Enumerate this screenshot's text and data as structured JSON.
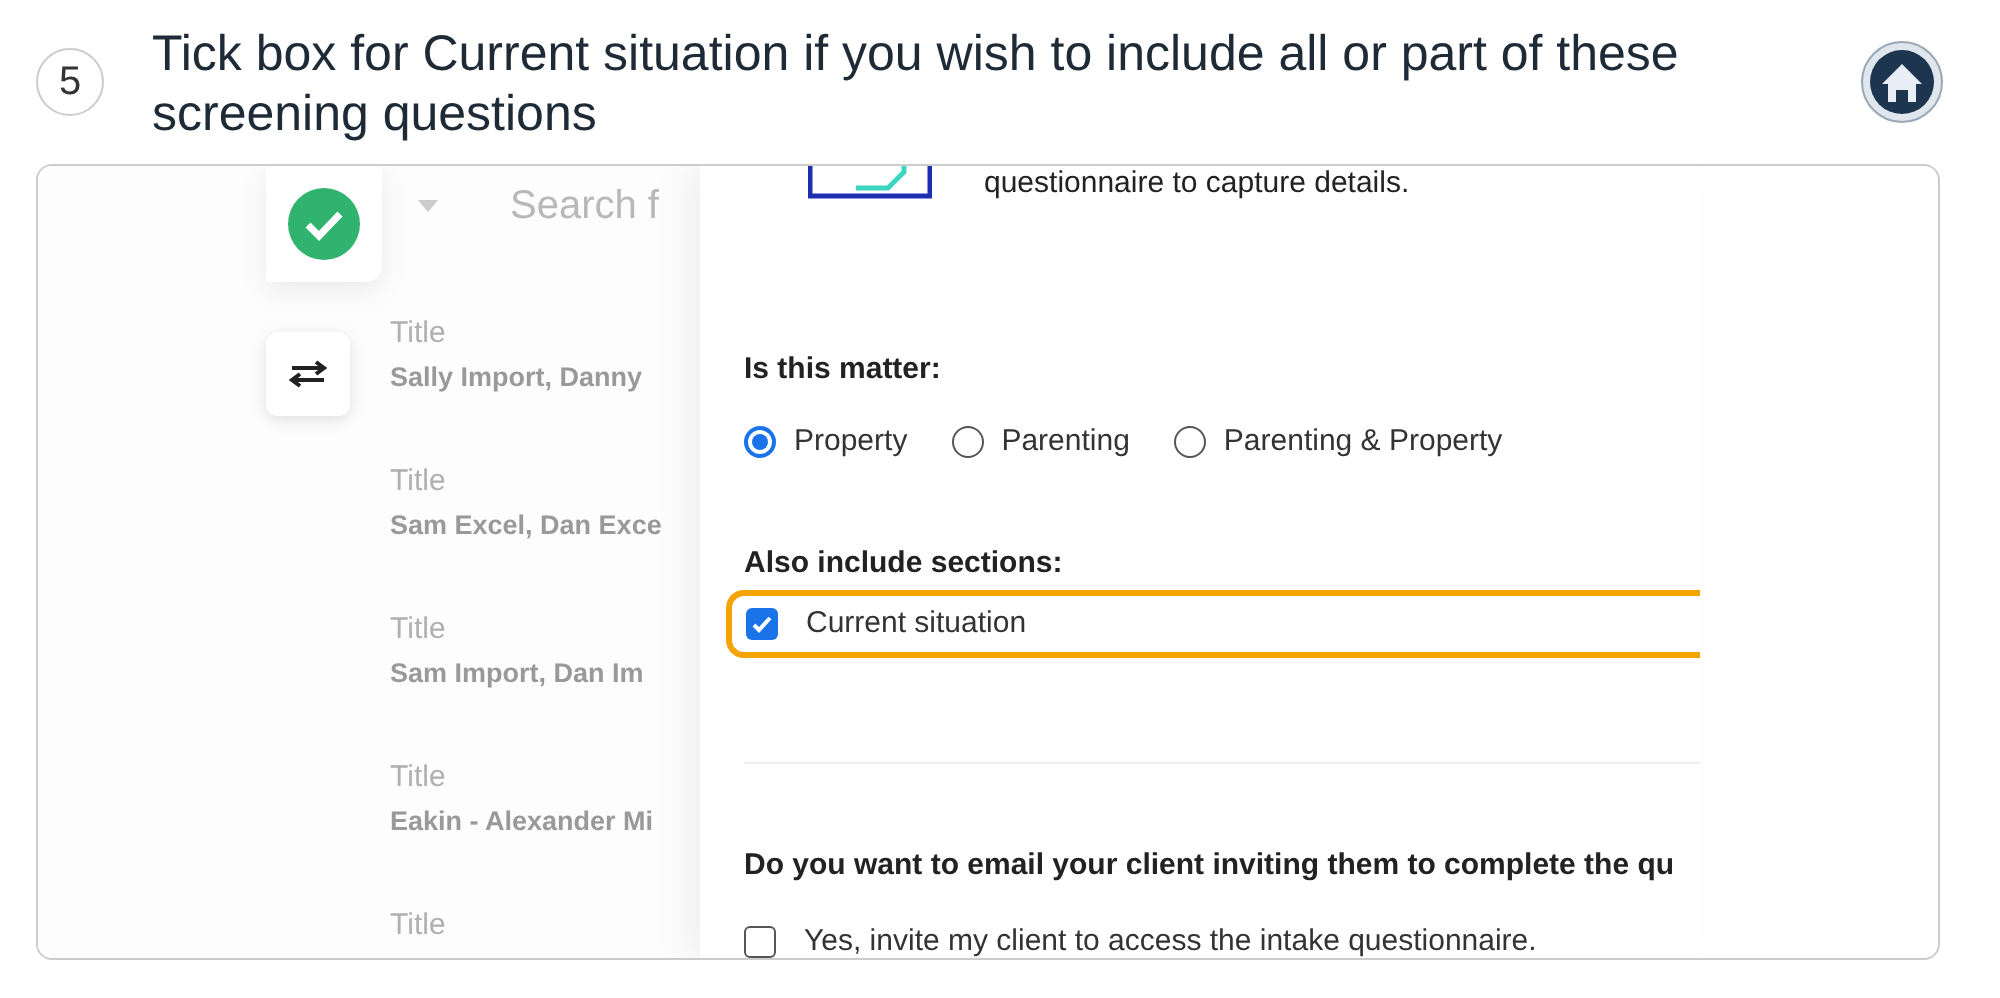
{
  "step": {
    "number": "5",
    "text": "Tick box for Current situation if you wish to include all or part of these screening questions"
  },
  "sidebar": {
    "search": {
      "placeholder": "Search f"
    },
    "items": [
      {
        "label": "Title",
        "name": "Sally Import, Danny"
      },
      {
        "label": "Title",
        "name": "Sam Excel, Dan Exce"
      },
      {
        "label": "Title",
        "name": "Sam Import, Dan Im"
      },
      {
        "label": "Title",
        "name": "Eakin - Alexander Mi"
      },
      {
        "label": "Title"
      }
    ]
  },
  "modal": {
    "intro": "questionnaire to capture details.",
    "matter": {
      "label": "Is this matter:",
      "options": [
        {
          "label": "Property",
          "selected": true
        },
        {
          "label": "Parenting",
          "selected": false
        },
        {
          "label": "Parenting & Property",
          "selected": false
        }
      ]
    },
    "sections": {
      "label": "Also include sections:",
      "items": [
        {
          "label": "Current situation",
          "checked": true,
          "highlighted": true
        }
      ]
    },
    "email": {
      "question": "Do you want to email your client inviting them to complete the qu",
      "options": [
        {
          "label": "Yes, invite my client to access the intake questionnaire.",
          "checked": false
        }
      ]
    }
  }
}
